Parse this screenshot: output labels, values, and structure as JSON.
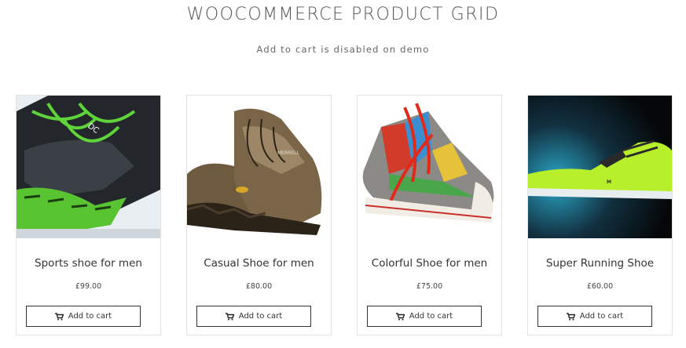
{
  "header": {
    "title": "WOOCOMMERCE PRODUCT GRID",
    "subtitle": "Add to cart is disabled on demo"
  },
  "products": [
    {
      "name": "Sports shoe for men",
      "price": "£99.00",
      "button_label": "Add to cart",
      "icon": "cart-icon"
    },
    {
      "name": "Casual Shoe for men",
      "price": "£80.00",
      "button_label": "Add to cart",
      "icon": "cart-icon"
    },
    {
      "name": "Colorful Shoe for men",
      "price": "£75.00",
      "button_label": "Add to cart",
      "icon": "cart-icon"
    },
    {
      "name": "Super Running Shoe",
      "price": "£60.00",
      "button_label": "Add to cart",
      "icon": "cart-icon"
    }
  ]
}
